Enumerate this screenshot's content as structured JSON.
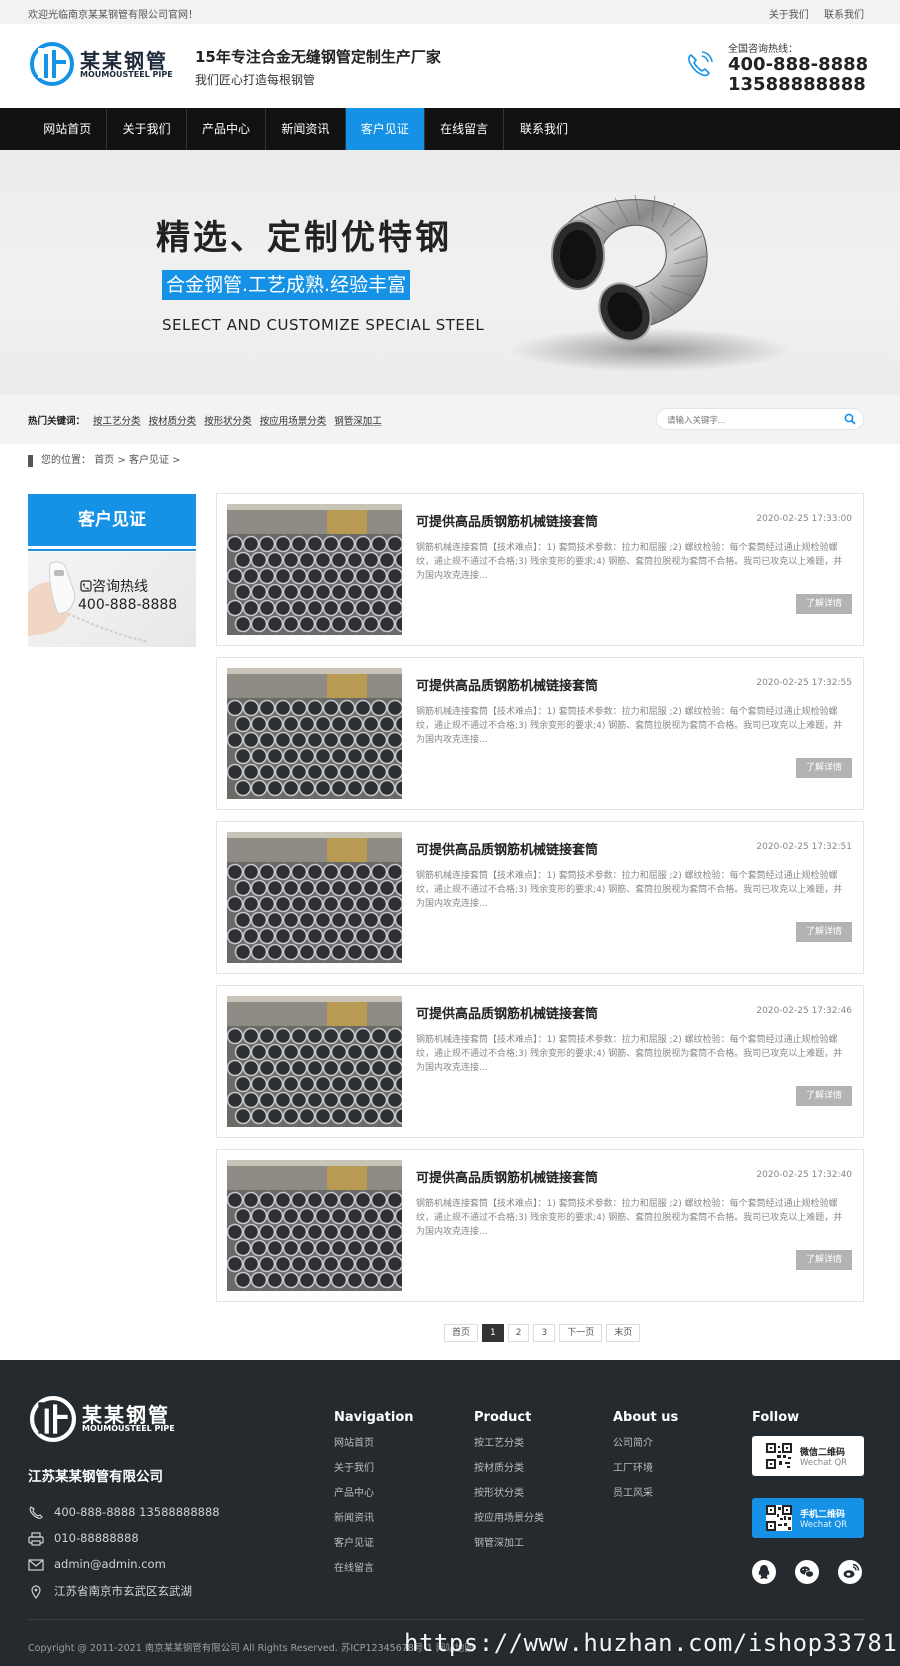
{
  "topbar": {
    "welcome": "欢迎光临南京某某钢管有限公司官网！",
    "links": [
      "关于我们",
      "联系我们"
    ]
  },
  "header": {
    "brand": "某某钢管",
    "brand_en": "MOUMOUSTEEL PIPE",
    "slogan_title": "15年专注合金无缝钢管定制生产厂家",
    "slogan_sub": "我们匠心打造每根钢管",
    "hotline_label": "全国咨询热线：",
    "hotline_1": "400-888-8888",
    "hotline_2": "13588888888"
  },
  "nav": {
    "items": [
      "网站首页",
      "关于我们",
      "产品中心",
      "新闻资讯",
      "客户见证",
      "在线留言",
      "联系我们"
    ],
    "active_index": 4
  },
  "banner": {
    "headline": "精选、定制优特钢",
    "tagline": "合金钢管.工艺成熟.经验丰富",
    "english": "SELECT AND CUSTOMIZE SPECIAL STEEL"
  },
  "hotbar": {
    "label": "热门关键词：",
    "keywords": [
      "按工艺分类",
      "按材质分类",
      "按形状分类",
      "按应用场景分类",
      "钢管深加工"
    ],
    "search_placeholder": "请输入关键字..."
  },
  "breadcrumb": {
    "prefix": "您的位置：",
    "home": "首页",
    "sep": ">",
    "current": "客户见证"
  },
  "sidebar": {
    "title": "客户见证",
    "contact_label": "咨询热线",
    "contact_number": "400-888-8888"
  },
  "articles": [
    {
      "title": "可提供高品质钢筋机械链接套筒",
      "date": "2020-02-25 17:33:00",
      "desc": "钢筋机械连接套筒【技术难点】：1) 套筒技术参数：拉力和屈服 ;2) 螺纹检验：每个套筒经过通止规检验螺纹，通止规不通过不合格;3) 残余变形的要求;4) 钢筋、套筒拉脱视为套筒不合格。我司已攻克以上难题，并为国内攻克连接...",
      "more": "了解详情"
    },
    {
      "title": "可提供高品质钢筋机械链接套筒",
      "date": "2020-02-25 17:32:55",
      "desc": "钢筋机械连接套筒【技术难点】：1) 套筒技术参数：拉力和屈服 ;2) 螺纹检验：每个套筒经过通止规检验螺纹，通止规不通过不合格;3) 残余变形的要求;4) 钢筋、套筒拉脱视为套筒不合格。我司已攻克以上难题，并为国内攻克连接...",
      "more": "了解详情"
    },
    {
      "title": "可提供高品质钢筋机械链接套筒",
      "date": "2020-02-25 17:32:51",
      "desc": "钢筋机械连接套筒【技术难点】：1) 套筒技术参数：拉力和屈服 ;2) 螺纹检验：每个套筒经过通止规检验螺纹，通止规不通过不合格;3) 残余变形的要求;4) 钢筋、套筒拉脱视为套筒不合格。我司已攻克以上难题，并为国内攻克连接...",
      "more": "了解详情"
    },
    {
      "title": "可提供高品质钢筋机械链接套筒",
      "date": "2020-02-25 17:32:46",
      "desc": "钢筋机械连接套筒【技术难点】：1) 套筒技术参数：拉力和屈服 ;2) 螺纹检验：每个套筒经过通止规检验螺纹，通止规不通过不合格;3) 残余变形的要求;4) 钢筋、套筒拉脱视为套筒不合格。我司已攻克以上难题，并为国内攻克连接...",
      "more": "了解详情"
    },
    {
      "title": "可提供高品质钢筋机械链接套筒",
      "date": "2020-02-25 17:32:40",
      "desc": "钢筋机械连接套筒【技术难点】：1) 套筒技术参数：拉力和屈服 ;2) 螺纹检验：每个套筒经过通止规检验螺纹，通止规不通过不合格;3) 残余变形的要求;4) 钢筋、套筒拉脱视为套筒不合格。我司已攻克以上难题，并为国内攻克连接...",
      "more": "了解详情"
    }
  ],
  "pager": {
    "first": "首页",
    "pages": [
      "1",
      "2",
      "3"
    ],
    "current": "1",
    "next": "下一页",
    "last": "末页"
  },
  "footer": {
    "brand": "某某钢管",
    "brand_en": "MOUMOUSTEEL PIPE",
    "company": "江苏某某钢管有限公司",
    "phone": "400-888-8888  13588888888",
    "fax": "010-88888888",
    "email": "admin@admin.com",
    "address": "江苏省南京市玄武区玄武湖",
    "nav_title": "Navigation",
    "nav_items": [
      "网站首页",
      "关于我们",
      "产品中心",
      "新闻资讯",
      "客户见证",
      "在线留言"
    ],
    "product_title": "Product",
    "product_items": [
      "按工艺分类",
      "按材质分类",
      "按形状分类",
      "按应用场景分类",
      "钢管深加工"
    ],
    "about_title": "About us",
    "about_items": [
      "公司简介",
      "工厂环境",
      "员工风采"
    ],
    "follow_title": "Follow",
    "wechat_qr_title": "微信二维码",
    "wechat_qr_sub": "Wechat QR",
    "mobile_qr_title": "手机二维码",
    "mobile_qr_sub": "Wechat QR",
    "copyright": "Copyright @ 2011-2021 南京某某钢管有限公司 All Rights Reserved. 苏ICP12345678号-1 网站地图",
    "watermark": "https://www.huzhan.com/ishop33781"
  },
  "colors": {
    "accent": "#1592e6",
    "nav_bg": "#111111",
    "footer_bg": "#252a2e"
  }
}
